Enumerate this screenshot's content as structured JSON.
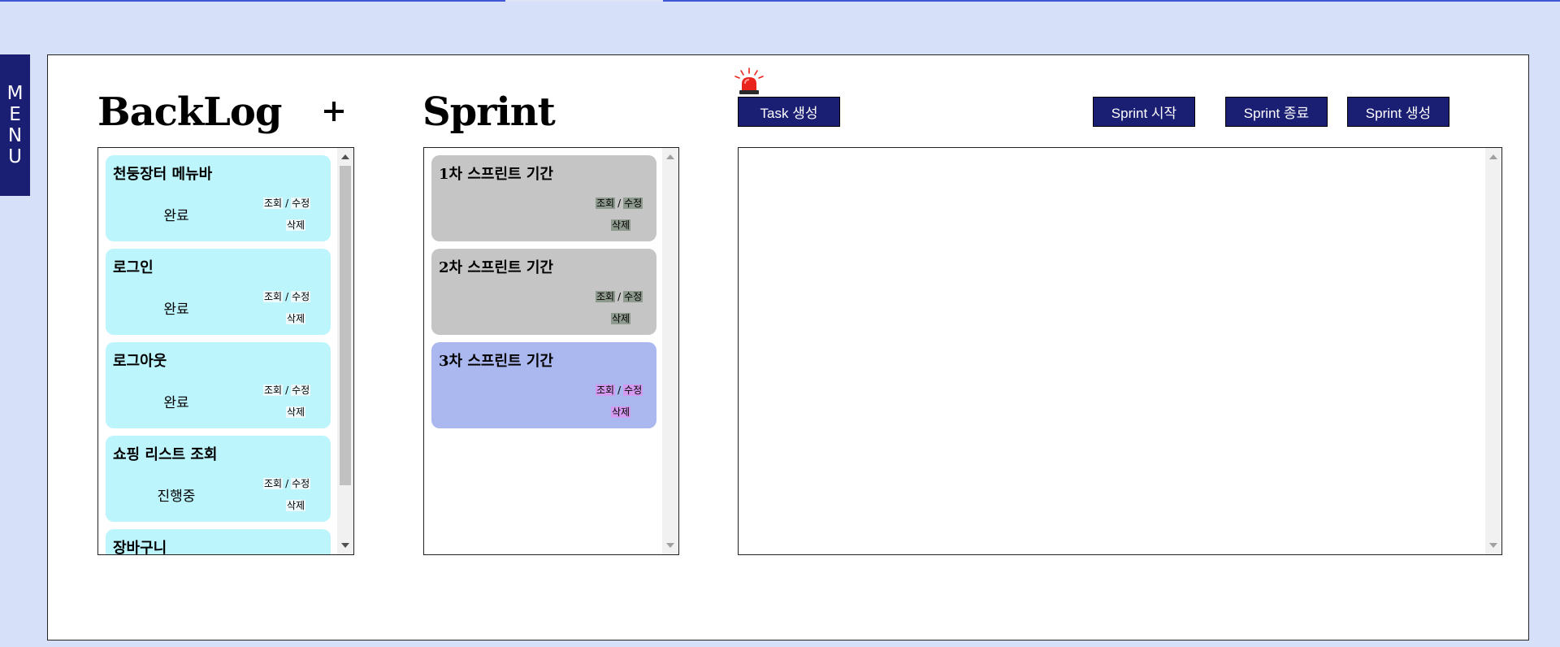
{
  "menu": {
    "letters": [
      "M",
      "E",
      "N",
      "U"
    ]
  },
  "backlog": {
    "title": "BackLog",
    "items": [
      {
        "title": "천둥장터 메뉴바",
        "status": "완료",
        "view_edit": "조회 / 수정",
        "view": "조회",
        "edit": "수정",
        "delete": "삭제"
      },
      {
        "title": "로그인",
        "status": "완료",
        "view": "조회",
        "edit": "수정",
        "delete": "삭제"
      },
      {
        "title": "로그아웃",
        "status": "완료",
        "view": "조회",
        "edit": "수정",
        "delete": "삭제"
      },
      {
        "title": "쇼핑 리스트 조회",
        "status": "진행중",
        "view": "조회",
        "edit": "수정",
        "delete": "삭제"
      },
      {
        "title": "장바구니"
      }
    ]
  },
  "sprint": {
    "title": "Sprint",
    "items": [
      {
        "title": "1차 스프린트 기간",
        "view": "조회",
        "edit": "수정",
        "delete": "삭제"
      },
      {
        "title": "2차 스프린트 기간",
        "view": "조회",
        "edit": "수정",
        "delete": "삭제"
      },
      {
        "title": "3차 스프린트 기간",
        "view": "조회",
        "edit": "수정",
        "delete": "삭제"
      }
    ]
  },
  "toolbar": {
    "task_create": "Task 생성",
    "sprint_start": "Sprint 시작",
    "sprint_end": "Sprint 종료",
    "sprint_create": "Sprint 생성"
  },
  "colors": {
    "page_bg": "#d6e1f9",
    "navy": "#1a1f73",
    "backlog_card": "#bdf5fd",
    "sprint_card_grey": "#c5c5c5",
    "sprint_card_selected": "#abb8ef",
    "alarm_red": "#e8241c"
  },
  "icons": {
    "alarm": "siren-icon",
    "add": "plus-icon"
  }
}
